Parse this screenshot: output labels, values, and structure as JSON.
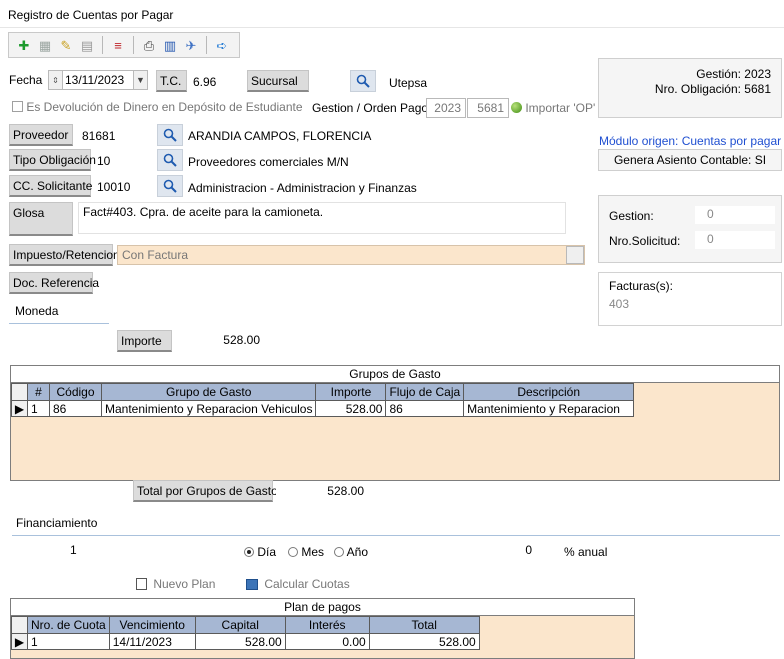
{
  "window": {
    "title": "Registro de Cuentas por Pagar"
  },
  "toolbar": {
    "icons": [
      "add-icon",
      "grid-icon",
      "edit-icon",
      "copy-icon",
      "delete-icon",
      "print-icon",
      "calc-icon",
      "tools-icon",
      "exit-icon"
    ]
  },
  "form": {
    "fecha_label": "Fecha",
    "fecha_value": "13/11/2023",
    "tc_label": "T.C.",
    "tc_value": "6.96",
    "sucursal_label": "Sucursal",
    "sucursal_value": "Utepsa",
    "devolucion_label": "Es Devolución de Dinero en Depósito de Estudiante",
    "gestion_orden_label": "Gestion / Orden Pago",
    "gestion_value": "2023",
    "orden_value": "5681",
    "importar_label": "Importar 'OP'",
    "proveedor_label": "Proveedor",
    "proveedor_code": "81681",
    "proveedor_name": "ARANDIA CAMPOS, FLORENCIA",
    "tipo_label": "Tipo Obligación",
    "tipo_code": "10",
    "tipo_name": "Proveedores comerciales M/N",
    "cc_label": "CC. Solicitante",
    "cc_code": "10010",
    "cc_name": "Administracion - Administracion y Finanzas",
    "glosa_label": "Glosa",
    "glosa_value": "Fact#403. Cpra. de aceite para la camioneta.",
    "impuesto_label": "Impuesto/Retencion",
    "impuesto_value": "Con Factura",
    "docref_label": "Doc. Referencia",
    "moneda_label": "Moneda",
    "importe_label": "Importe",
    "importe_value": "528.00"
  },
  "right_panel": {
    "gestion_line": "Gestión: 2023",
    "obligacion_line": "Nro. Obligación: 5681",
    "modulo_origen": "Módulo origen: Cuentas por pagar",
    "genera_asiento": "Genera Asiento Contable: SI",
    "gestion_label": "Gestion:",
    "gestion_value": "0",
    "solicitud_label": "Nro.Solicitud:",
    "solicitud_value": "0",
    "facturas_label": "Facturas(s):",
    "facturas_value": "403"
  },
  "grupos_gasto": {
    "title": "Grupos de Gasto",
    "columns": [
      "#",
      "Código",
      "Grupo de Gasto",
      "Importe",
      "Flujo de Caja",
      "Descripción"
    ],
    "rows": [
      [
        "1",
        "86",
        "Mantenimiento y Reparacion Vehiculos",
        "528.00",
        "86",
        "Mantenimiento y Reparacion"
      ]
    ],
    "total_label": "Total por Grupos de Gasto",
    "total_value": "528.00"
  },
  "financiamiento": {
    "label": "Financiamiento",
    "quantity": "1",
    "options": [
      "Día",
      "Mes",
      "Año"
    ],
    "selected": "Día",
    "rate_value": "0",
    "rate_label": "% anual",
    "nuevo_plan_label": "Nuevo Plan",
    "calcular_label": "Calcular Cuotas"
  },
  "plan_pagos": {
    "title": "Plan de pagos",
    "columns": [
      "Nro. de Cuota",
      "Vencimiento",
      "Capital",
      "Interés",
      "Total"
    ],
    "rows": [
      [
        "1",
        "14/11/2023",
        "528.00",
        "0.00",
        "528.00"
      ]
    ]
  },
  "colors": {
    "grid_header": "#a6b7d3",
    "grid_body": "#fbe6cc",
    "link_blue": "#1f4fd1",
    "label_button": "#dcdcdc"
  }
}
